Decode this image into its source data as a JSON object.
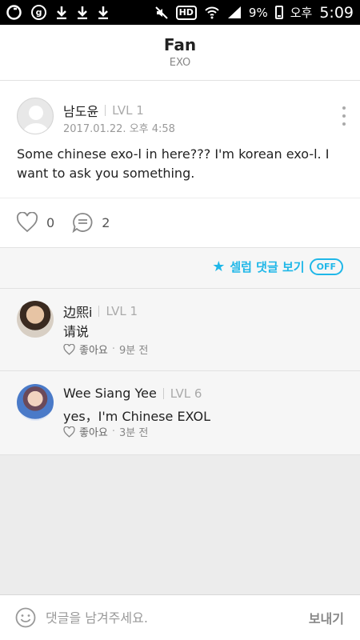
{
  "status_bar": {
    "battery": "9%",
    "ampm": "오후",
    "time": "5:09",
    "hd_label": "HD",
    "g_label": "g"
  },
  "header": {
    "title": "Fan",
    "subtitle": "EXO"
  },
  "post": {
    "author": "남도윤",
    "level": "LVL 1",
    "date": "2017.01.22. 오후 4:58",
    "body": "Some chinese exo-l in here??? I'm korean exo-l. I want to ask you something.",
    "like_count": "0",
    "comment_count": "2"
  },
  "celeb_filter": {
    "label": "셀럽 댓글 보기",
    "state": "OFF",
    "accent_color": "#1fb7e8"
  },
  "comments": [
    {
      "author": "边熙i",
      "level": "LVL 1",
      "text": "请说",
      "like_label": "좋아요",
      "time": "9분 전"
    },
    {
      "author": "Wee Siang Yee",
      "level": "LVL 6",
      "text": "yes，I'm Chinese EXOL",
      "like_label": "좋아요",
      "time": "3분 전"
    }
  ],
  "input_bar": {
    "placeholder": "댓글을 남겨주세요.",
    "send_label": "보내기"
  }
}
